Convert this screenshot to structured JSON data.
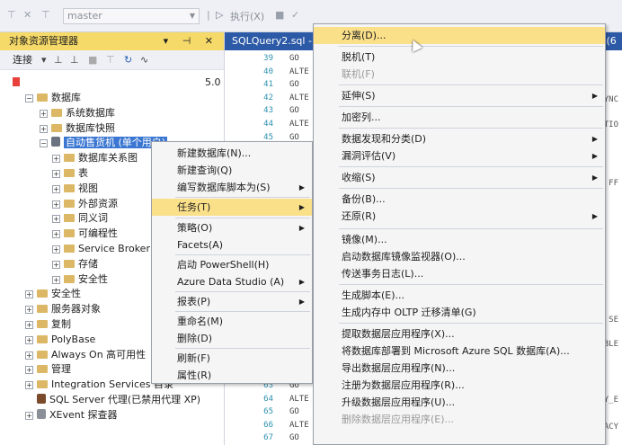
{
  "toolbar": {
    "db_value": "master",
    "execute_label": "执行(X)"
  },
  "oe": {
    "title": "对象资源管理器",
    "connect_label": "连接",
    "server_suffix": "5.0"
  },
  "tree": [
    {
      "label": "数据库",
      "level": 1,
      "expander": "−",
      "icon": "folder"
    },
    {
      "label": "系统数据库",
      "level": 2,
      "expander": "+",
      "icon": "folder"
    },
    {
      "label": "数据库快照",
      "level": 2,
      "expander": "+",
      "icon": "folder"
    },
    {
      "label": "自动售货机 (单个用户)",
      "level": 2,
      "expander": "−",
      "icon": "database",
      "selected": true
    },
    {
      "label": "数据库关系图",
      "level": 3,
      "expander": "+",
      "icon": "folder"
    },
    {
      "label": "表",
      "level": 3,
      "expander": "+",
      "icon": "folder"
    },
    {
      "label": "视图",
      "level": 3,
      "expander": "+",
      "icon": "folder"
    },
    {
      "label": "外部资源",
      "level": 3,
      "expander": "+",
      "icon": "folder"
    },
    {
      "label": "同义词",
      "level": 3,
      "expander": "+",
      "icon": "folder"
    },
    {
      "label": "可编程性",
      "level": 3,
      "expander": "+",
      "icon": "folder"
    },
    {
      "label": "Service Broker",
      "level": 3,
      "expander": "+",
      "icon": "folder"
    },
    {
      "label": "存储",
      "level": 3,
      "expander": "+",
      "icon": "folder"
    },
    {
      "label": "安全性",
      "level": 3,
      "expander": "+",
      "icon": "folder"
    },
    {
      "label": "安全性",
      "level": 1,
      "expander": "+",
      "icon": "folder"
    },
    {
      "label": "服务器对象",
      "level": 1,
      "expander": "+",
      "icon": "folder"
    },
    {
      "label": "复制",
      "level": 1,
      "expander": "+",
      "icon": "folder"
    },
    {
      "label": "PolyBase",
      "level": 1,
      "expander": "+",
      "icon": "folder"
    },
    {
      "label": "Always On 高可用性",
      "level": 1,
      "expander": "+",
      "icon": "folder"
    },
    {
      "label": "管理",
      "level": 1,
      "expander": "+",
      "icon": "folder"
    },
    {
      "label": "Integration Services 目录",
      "level": 1,
      "expander": "+",
      "icon": "folder"
    },
    {
      "label": "SQL Server 代理(已禁用代理 XP)",
      "level": 1,
      "expander": "",
      "icon": "agent"
    },
    {
      "label": "XEvent 探查器",
      "level": 1,
      "expander": "+",
      "icon": "xevent"
    }
  ],
  "editor": {
    "tab_title": "SQLQuery2.sql -",
    "right_tab_tail": "n (6",
    "lines": [
      {
        "n": "39",
        "t": "GO"
      },
      {
        "n": "40",
        "t": "ALTE"
      },
      {
        "n": "41",
        "t": "GO"
      },
      {
        "n": "42",
        "t": "ALTE"
      },
      {
        "n": "43",
        "t": "GO"
      },
      {
        "n": "44",
        "t": "ALTE"
      },
      {
        "n": "45",
        "t": "GO"
      },
      {
        "n": "63",
        "t": "GO"
      },
      {
        "n": "64",
        "t": "ALTE"
      },
      {
        "n": "65",
        "t": "GO"
      },
      {
        "n": "66",
        "t": "ALTE"
      },
      {
        "n": "67",
        "t": "GO"
      }
    ],
    "right_fragments": [
      "YNC",
      "TIO",
      "FF",
      "SE",
      "BLE",
      "Y_E",
      "ACY"
    ]
  },
  "context_menu": [
    {
      "label": "新建数据库(N)...",
      "sub": false
    },
    {
      "label": "新建查询(Q)",
      "sub": false
    },
    {
      "label": "编写数据库脚本为(S)",
      "sub": true
    },
    {
      "label": "任务(T)",
      "sub": true,
      "highlight": true
    },
    {
      "label": "策略(O)",
      "sub": true
    },
    {
      "label": "Facets(A)",
      "sub": false
    },
    {
      "label": "启动 PowerShell(H)",
      "sub": false
    },
    {
      "label": "Azure Data Studio (A)",
      "sub": true
    },
    {
      "label": "报表(P)",
      "sub": true
    },
    {
      "label": "重命名(M)",
      "sub": false
    },
    {
      "label": "删除(D)",
      "sub": false
    },
    {
      "label": "刷新(F)",
      "sub": false
    },
    {
      "label": "属性(R)",
      "sub": false
    }
  ],
  "task_menu": [
    {
      "label": "分离(D)...",
      "highlight": true
    },
    {
      "label": "脱机(T)"
    },
    {
      "label": "联机(F)",
      "disabled": true
    },
    {
      "label": "延伸(S)",
      "sub": true
    },
    {
      "label": "加密列..."
    },
    {
      "label": "数据发现和分类(D)",
      "sub": true
    },
    {
      "label": "漏洞评估(V)",
      "sub": true
    },
    {
      "label": "收缩(S)",
      "sub": true
    },
    {
      "label": "备份(B)..."
    },
    {
      "label": "还原(R)",
      "sub": true
    },
    {
      "label": "镜像(M)..."
    },
    {
      "label": "启动数据库镜像监视器(O)..."
    },
    {
      "label": "传送事务日志(L)..."
    },
    {
      "label": "生成脚本(E)..."
    },
    {
      "label": "生成内存中 OLTP 迁移清单(G)"
    },
    {
      "label": "提取数据层应用程序(X)..."
    },
    {
      "label": "将数据库部署到 Microsoft Azure SQL 数据库(A)..."
    },
    {
      "label": "导出数据层应用程序(N)..."
    },
    {
      "label": "注册为数据层应用程序(R)..."
    },
    {
      "label": "升级数据层应用程序(U)..."
    },
    {
      "label": "删除数据层应用程序(E)...",
      "disabled": true
    }
  ]
}
